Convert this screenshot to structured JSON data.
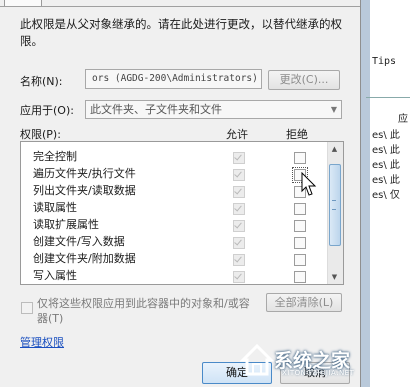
{
  "dialog": {
    "description": "此权限是从父对象继承的。请在此处进行更改，以替代继承的权限。",
    "name_label": "名称(N):",
    "name_value": "ors (AGDG-200\\Administrators)",
    "change_button": "更改(C)...",
    "apply_to_label": "应用于(O):",
    "apply_to_value": "此文件夹、子文件夹和文件",
    "permissions_label": "权限(P):",
    "allow_header": "允许",
    "deny_header": "拒绝",
    "permissions": [
      {
        "label": "完全控制",
        "allow": true,
        "deny": false
      },
      {
        "label": "遍历文件夹/执行文件",
        "allow": true,
        "deny": false
      },
      {
        "label": "列出文件夹/读取数据",
        "allow": true,
        "deny": false
      },
      {
        "label": "读取属性",
        "allow": true,
        "deny": false
      },
      {
        "label": "读取扩展属性",
        "allow": true,
        "deny": false
      },
      {
        "label": "创建文件/写入数据",
        "allow": true,
        "deny": false
      },
      {
        "label": "创建文件夹/附加数据",
        "allow": true,
        "deny": false
      },
      {
        "label": "写入属性",
        "allow": true,
        "deny": false
      }
    ],
    "apply_only_text": "仅将这些权限应用到此容器中的对象和/或容器(T)",
    "clear_all_button": "全部清除(L)",
    "manage_link": "管理权限",
    "ok_button": "确定",
    "cancel_button": "取消"
  },
  "background": {
    "tips": "Tips",
    "col_char": "应",
    "rows": [
      "es\\ 此",
      "es\\ 此",
      "es\\ 此",
      "es\\ 此",
      "es\\ 仅"
    ]
  },
  "watermark": {
    "text": "系统之家",
    "sub": "XITONGZHIJIA.NET"
  },
  "colors": {
    "link": "#1a4fbf",
    "dialog_bg": "#f0f0f0",
    "ok_border": "#4a8ac8"
  }
}
